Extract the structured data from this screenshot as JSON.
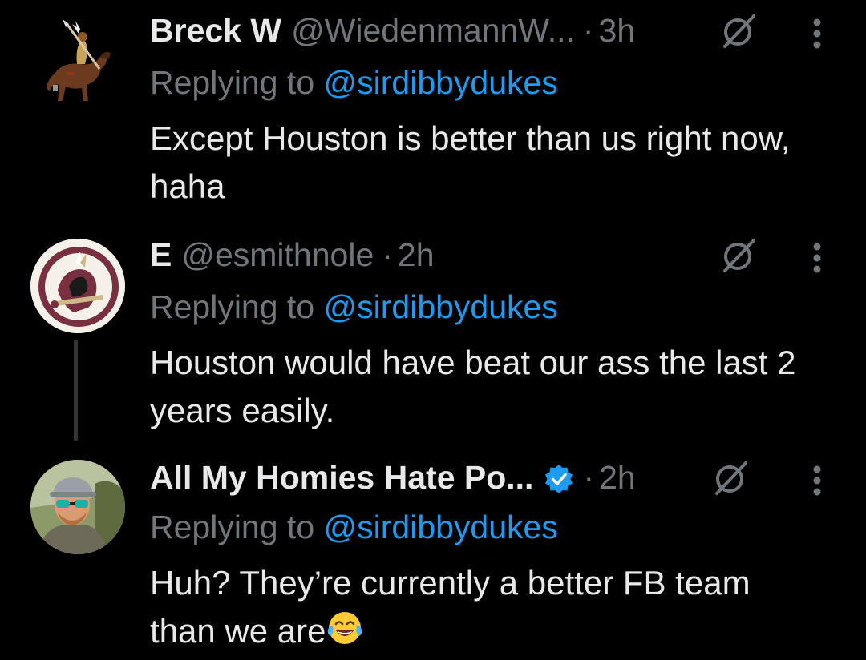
{
  "tweets": [
    {
      "name": "Breck W",
      "handle": "@WiedenmannW...",
      "separator": "·",
      "time": "3h",
      "reply_prefix": "Replying to",
      "reply_to": "@sirdibbydukes",
      "text": "Except Houston is better than us right now, haha",
      "avatar_icon": "horse-rider-avatar",
      "verified": false
    },
    {
      "name": "E",
      "handle": "@esmithnole",
      "separator": "·",
      "time": "2h",
      "reply_prefix": "Replying to",
      "reply_to": "@sirdibbydukes",
      "text": "Houston would have beat our ass the last 2 years easily.",
      "avatar_icon": "seminole-logo-avatar",
      "verified": false
    },
    {
      "name": "All My Homies Hate Po...",
      "handle": "",
      "separator": "·",
      "time": "2h",
      "reply_prefix": "Replying to",
      "reply_to": "@sirdibbydukes",
      "text": "Huh? They’re currently a better FB team than we are",
      "avatar_icon": "person-sunglasses-avatar",
      "verified": true,
      "emoji": "face-with-tears-of-joy"
    }
  ],
  "icons": {
    "grok": "grok-icon",
    "more": "more-vertical-icon",
    "verified": "verified-badge-icon"
  },
  "colors": {
    "background": "#000000",
    "text": "#e7e9ea",
    "secondary": "#71767b",
    "link": "#1d9bf0",
    "verified": "#1d9bf0",
    "thread_line": "#333639"
  }
}
